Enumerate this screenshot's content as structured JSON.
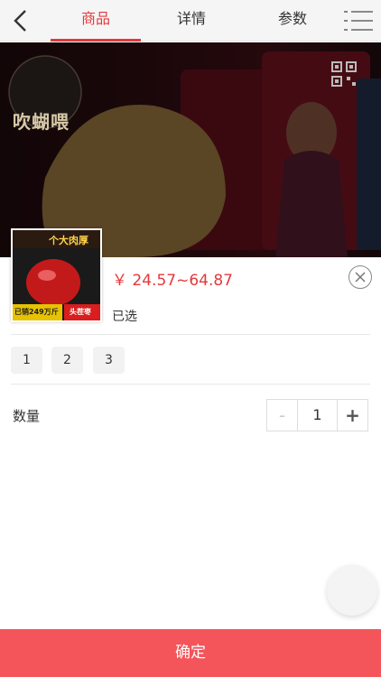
{
  "nav": {
    "tabs": [
      {
        "label": "商品",
        "active": true
      },
      {
        "label": "详情",
        "active": false
      },
      {
        "label": "参数",
        "active": false
      }
    ],
    "icons": {
      "back": "chevron-left-icon",
      "menu": "menu-icon"
    }
  },
  "banner": {
    "brand_text": "吹蝴喂",
    "qr_icon": "qr-code-icon"
  },
  "product": {
    "thumb_caption": "个大肉厚",
    "thumb_sold": "已销249万斤",
    "thumb_grade": "头茬枣",
    "price": "￥ 24.57~64.87",
    "selected_label": "已选"
  },
  "options": [
    "1",
    "2",
    "3"
  ],
  "quantity": {
    "label": "数量",
    "minus": "-",
    "value": "1",
    "plus": "+"
  },
  "footer": {
    "confirm_label": "确定"
  },
  "colors": {
    "accent": "#e4393c",
    "confirm_bg": "#f3555a"
  }
}
